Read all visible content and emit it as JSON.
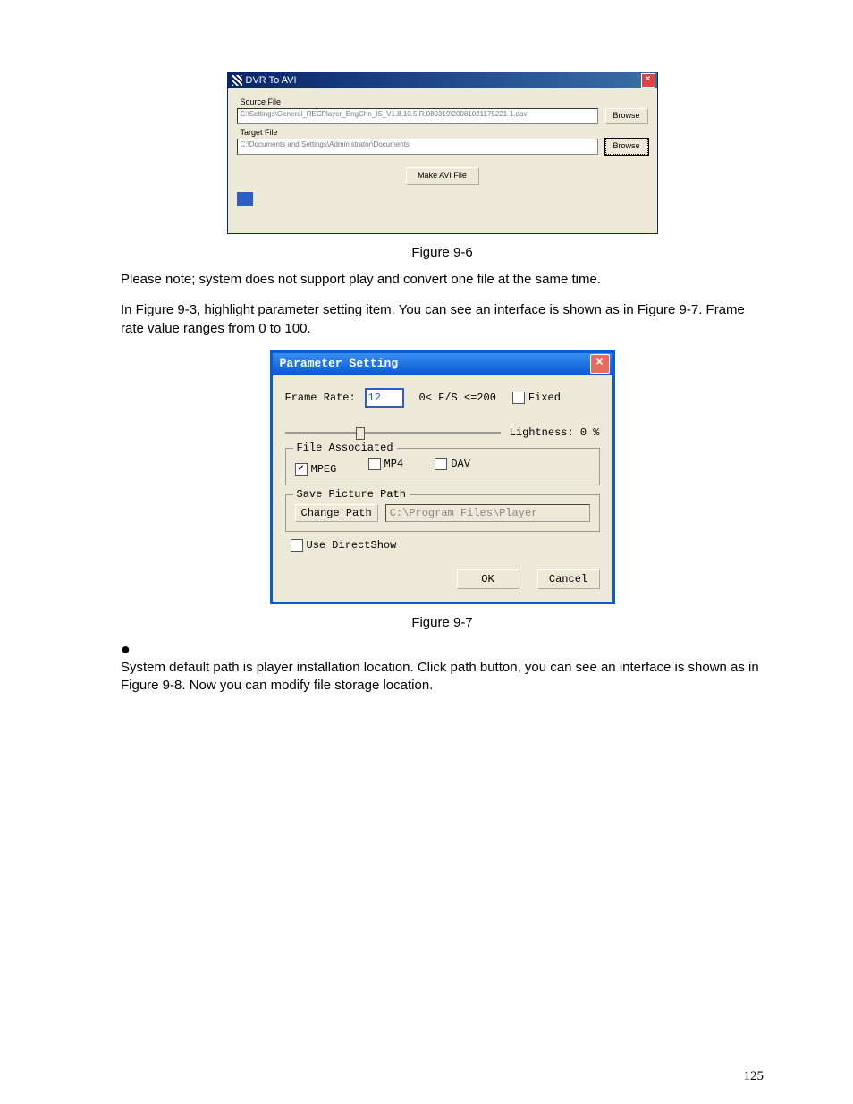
{
  "page_number": "125",
  "figure1_caption": "Figure 9-6",
  "figure2_caption": "Figure 9-7",
  "para1": "Please note; system does not support play and convert one file at the same time.",
  "para2": "In Figure 9-3, highlight parameter setting item.  You can see an interface is shown as in Figure 9-7. Frame rate value ranges from 0 to 100.",
  "para3": "System default path is player installation location. Click path button, you can see an interface is shown as in Figure 9-8. Now you can modify file storage location.",
  "bullet": "●",
  "dlg1": {
    "title": "DVR To AVI",
    "source_label": "Source File",
    "source_value": "C:\\Settings\\General_RECPlayer_EngChn_IS_V1.8.10.5.R.080319\\20081021175221-1.dav",
    "target_label": "Target File",
    "target_value": "C:\\Documents and Settings\\Administrator\\Documents",
    "browse": "Browse",
    "make": "Make AVI File"
  },
  "dlg2": {
    "title": "Parameter Setting",
    "frame_rate_label": "Frame Rate:",
    "frame_rate_value": "12",
    "frame_rate_range": "0< F/S <=200",
    "fixed_label": "Fixed",
    "lightness_label": "Lightness: 0   %",
    "file_assoc_legend": "File Associated",
    "mpeg": "MPEG",
    "mp4": "MP4",
    "dav": "DAV",
    "save_legend": "Save Picture Path",
    "change_path": "Change Path",
    "save_path_value": "C:\\Program Files\\Player",
    "directshow": "Use DirectShow",
    "ok": "OK",
    "cancel": "Cancel"
  }
}
